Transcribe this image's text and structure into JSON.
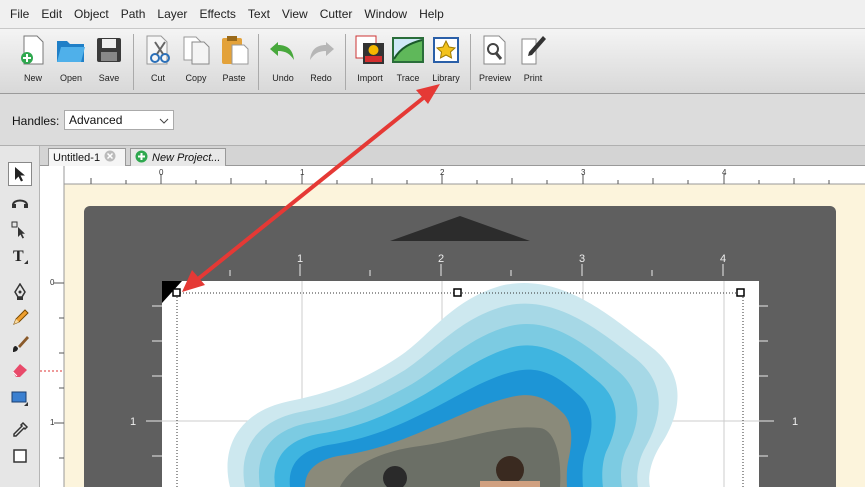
{
  "menu": [
    "File",
    "Edit",
    "Object",
    "Path",
    "Layer",
    "Effects",
    "Text",
    "View",
    "Cutter",
    "Window",
    "Help"
  ],
  "toolbar": {
    "buttons": [
      {
        "label": "New",
        "icon": "new-doc-icon"
      },
      {
        "label": "Open",
        "icon": "open-folder-icon"
      },
      {
        "label": "Save",
        "icon": "save-disk-icon"
      },
      {
        "label": "Cut",
        "icon": "scissors-icon"
      },
      {
        "label": "Copy",
        "icon": "copy-icon"
      },
      {
        "label": "Paste",
        "icon": "paste-icon"
      },
      {
        "label": "Undo",
        "icon": "undo-icon"
      },
      {
        "label": "Redo",
        "icon": "redo-icon"
      },
      {
        "label": "Import",
        "icon": "import-svg-icon"
      },
      {
        "label": "Trace",
        "icon": "trace-icon"
      },
      {
        "label": "Library",
        "icon": "library-star-icon"
      },
      {
        "label": "Preview",
        "icon": "preview-magnifier-icon"
      },
      {
        "label": "Print",
        "icon": "print-pen-icon"
      }
    ]
  },
  "handles": {
    "label": "Handles:",
    "value": "Advanced"
  },
  "tabs": [
    {
      "label": "Untitled-1"
    },
    {
      "label": "New Project..."
    }
  ],
  "rulers": {
    "top": [
      "0",
      "1",
      "2",
      "3",
      "4"
    ],
    "mat_top": [
      "1",
      "2",
      "3",
      "4"
    ],
    "left": [
      "0",
      "1"
    ],
    "mat_left": [
      "1"
    ],
    "mat_right": [
      "1"
    ]
  },
  "colors": {
    "toolbar_bg": "#dcdcdc",
    "canvas_bg": "#fcf4dc",
    "mat": "#5f5f5f",
    "annotation_arrow": "#e53935",
    "shape_outer": "#b3dde9",
    "shape_mid": "#5ec8e6",
    "shape_inner": "#1a8fd4"
  }
}
